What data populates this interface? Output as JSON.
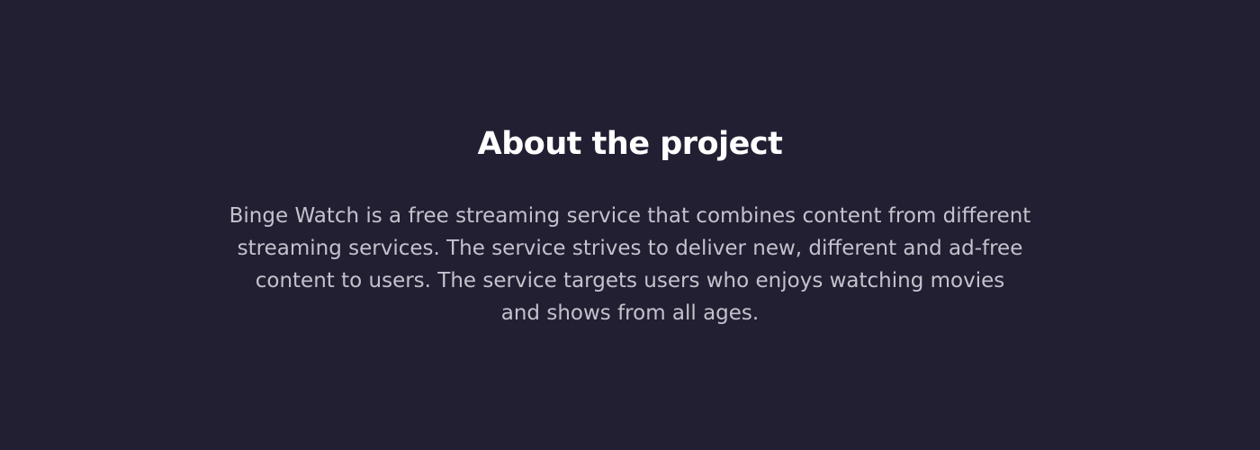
{
  "section": {
    "title": "About the project",
    "lines": [
      "Binge Watch is a free streaming service that combines content from different",
      "streaming services. The service strives to deliver new, different and ad-free",
      "content to users. The service targets users who enjoys watching movies",
      "and shows from all ages."
    ]
  }
}
